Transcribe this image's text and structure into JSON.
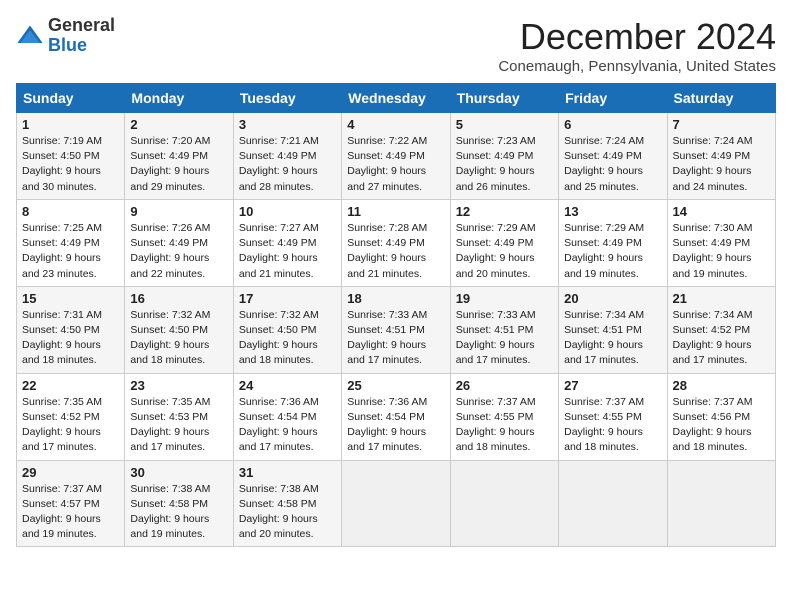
{
  "logo": {
    "general": "General",
    "blue": "Blue"
  },
  "title": "December 2024",
  "subtitle": "Conemaugh, Pennsylvania, United States",
  "days_of_week": [
    "Sunday",
    "Monday",
    "Tuesday",
    "Wednesday",
    "Thursday",
    "Friday",
    "Saturday"
  ],
  "weeks": [
    [
      {
        "day": "1",
        "sunrise": "Sunrise: 7:19 AM",
        "sunset": "Sunset: 4:50 PM",
        "daylight": "Daylight: 9 hours and 30 minutes."
      },
      {
        "day": "2",
        "sunrise": "Sunrise: 7:20 AM",
        "sunset": "Sunset: 4:49 PM",
        "daylight": "Daylight: 9 hours and 29 minutes."
      },
      {
        "day": "3",
        "sunrise": "Sunrise: 7:21 AM",
        "sunset": "Sunset: 4:49 PM",
        "daylight": "Daylight: 9 hours and 28 minutes."
      },
      {
        "day": "4",
        "sunrise": "Sunrise: 7:22 AM",
        "sunset": "Sunset: 4:49 PM",
        "daylight": "Daylight: 9 hours and 27 minutes."
      },
      {
        "day": "5",
        "sunrise": "Sunrise: 7:23 AM",
        "sunset": "Sunset: 4:49 PM",
        "daylight": "Daylight: 9 hours and 26 minutes."
      },
      {
        "day": "6",
        "sunrise": "Sunrise: 7:24 AM",
        "sunset": "Sunset: 4:49 PM",
        "daylight": "Daylight: 9 hours and 25 minutes."
      },
      {
        "day": "7",
        "sunrise": "Sunrise: 7:24 AM",
        "sunset": "Sunset: 4:49 PM",
        "daylight": "Daylight: 9 hours and 24 minutes."
      }
    ],
    [
      {
        "day": "8",
        "sunrise": "Sunrise: 7:25 AM",
        "sunset": "Sunset: 4:49 PM",
        "daylight": "Daylight: 9 hours and 23 minutes."
      },
      {
        "day": "9",
        "sunrise": "Sunrise: 7:26 AM",
        "sunset": "Sunset: 4:49 PM",
        "daylight": "Daylight: 9 hours and 22 minutes."
      },
      {
        "day": "10",
        "sunrise": "Sunrise: 7:27 AM",
        "sunset": "Sunset: 4:49 PM",
        "daylight": "Daylight: 9 hours and 21 minutes."
      },
      {
        "day": "11",
        "sunrise": "Sunrise: 7:28 AM",
        "sunset": "Sunset: 4:49 PM",
        "daylight": "Daylight: 9 hours and 21 minutes."
      },
      {
        "day": "12",
        "sunrise": "Sunrise: 7:29 AM",
        "sunset": "Sunset: 4:49 PM",
        "daylight": "Daylight: 9 hours and 20 minutes."
      },
      {
        "day": "13",
        "sunrise": "Sunrise: 7:29 AM",
        "sunset": "Sunset: 4:49 PM",
        "daylight": "Daylight: 9 hours and 19 minutes."
      },
      {
        "day": "14",
        "sunrise": "Sunrise: 7:30 AM",
        "sunset": "Sunset: 4:49 PM",
        "daylight": "Daylight: 9 hours and 19 minutes."
      }
    ],
    [
      {
        "day": "15",
        "sunrise": "Sunrise: 7:31 AM",
        "sunset": "Sunset: 4:50 PM",
        "daylight": "Daylight: 9 hours and 18 minutes."
      },
      {
        "day": "16",
        "sunrise": "Sunrise: 7:32 AM",
        "sunset": "Sunset: 4:50 PM",
        "daylight": "Daylight: 9 hours and 18 minutes."
      },
      {
        "day": "17",
        "sunrise": "Sunrise: 7:32 AM",
        "sunset": "Sunset: 4:50 PM",
        "daylight": "Daylight: 9 hours and 18 minutes."
      },
      {
        "day": "18",
        "sunrise": "Sunrise: 7:33 AM",
        "sunset": "Sunset: 4:51 PM",
        "daylight": "Daylight: 9 hours and 17 minutes."
      },
      {
        "day": "19",
        "sunrise": "Sunrise: 7:33 AM",
        "sunset": "Sunset: 4:51 PM",
        "daylight": "Daylight: 9 hours and 17 minutes."
      },
      {
        "day": "20",
        "sunrise": "Sunrise: 7:34 AM",
        "sunset": "Sunset: 4:51 PM",
        "daylight": "Daylight: 9 hours and 17 minutes."
      },
      {
        "day": "21",
        "sunrise": "Sunrise: 7:34 AM",
        "sunset": "Sunset: 4:52 PM",
        "daylight": "Daylight: 9 hours and 17 minutes."
      }
    ],
    [
      {
        "day": "22",
        "sunrise": "Sunrise: 7:35 AM",
        "sunset": "Sunset: 4:52 PM",
        "daylight": "Daylight: 9 hours and 17 minutes."
      },
      {
        "day": "23",
        "sunrise": "Sunrise: 7:35 AM",
        "sunset": "Sunset: 4:53 PM",
        "daylight": "Daylight: 9 hours and 17 minutes."
      },
      {
        "day": "24",
        "sunrise": "Sunrise: 7:36 AM",
        "sunset": "Sunset: 4:54 PM",
        "daylight": "Daylight: 9 hours and 17 minutes."
      },
      {
        "day": "25",
        "sunrise": "Sunrise: 7:36 AM",
        "sunset": "Sunset: 4:54 PM",
        "daylight": "Daylight: 9 hours and 17 minutes."
      },
      {
        "day": "26",
        "sunrise": "Sunrise: 7:37 AM",
        "sunset": "Sunset: 4:55 PM",
        "daylight": "Daylight: 9 hours and 18 minutes."
      },
      {
        "day": "27",
        "sunrise": "Sunrise: 7:37 AM",
        "sunset": "Sunset: 4:55 PM",
        "daylight": "Daylight: 9 hours and 18 minutes."
      },
      {
        "day": "28",
        "sunrise": "Sunrise: 7:37 AM",
        "sunset": "Sunset: 4:56 PM",
        "daylight": "Daylight: 9 hours and 18 minutes."
      }
    ],
    [
      {
        "day": "29",
        "sunrise": "Sunrise: 7:37 AM",
        "sunset": "Sunset: 4:57 PM",
        "daylight": "Daylight: 9 hours and 19 minutes."
      },
      {
        "day": "30",
        "sunrise": "Sunrise: 7:38 AM",
        "sunset": "Sunset: 4:58 PM",
        "daylight": "Daylight: 9 hours and 19 minutes."
      },
      {
        "day": "31",
        "sunrise": "Sunrise: 7:38 AM",
        "sunset": "Sunset: 4:58 PM",
        "daylight": "Daylight: 9 hours and 20 minutes."
      },
      null,
      null,
      null,
      null
    ]
  ]
}
